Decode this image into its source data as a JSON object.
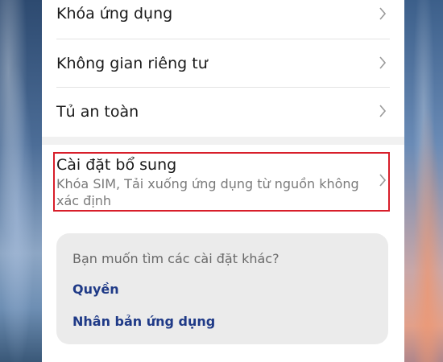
{
  "settings": {
    "items": [
      {
        "label": "Khóa ứng dụng"
      },
      {
        "label": "Không gian riêng tư"
      },
      {
        "label": "Tủ an toàn"
      }
    ],
    "additional": {
      "title": "Cài đặt bổ sung",
      "description": "Khóa SIM, Tải xuống ứng dụng từ nguồn không xác định"
    }
  },
  "suggestions": {
    "title": "Bạn muốn tìm các cài đặt khác?",
    "links": [
      {
        "label": "Quyền"
      },
      {
        "label": "Nhân bản ứng dụng"
      }
    ]
  },
  "colors": {
    "highlight_border": "#d81e2a",
    "link": "#1f3a87",
    "panel_background": "#f1f1f1",
    "card_background": "#ebebeb"
  },
  "icons": {
    "chevron": "chevron-right-icon"
  }
}
